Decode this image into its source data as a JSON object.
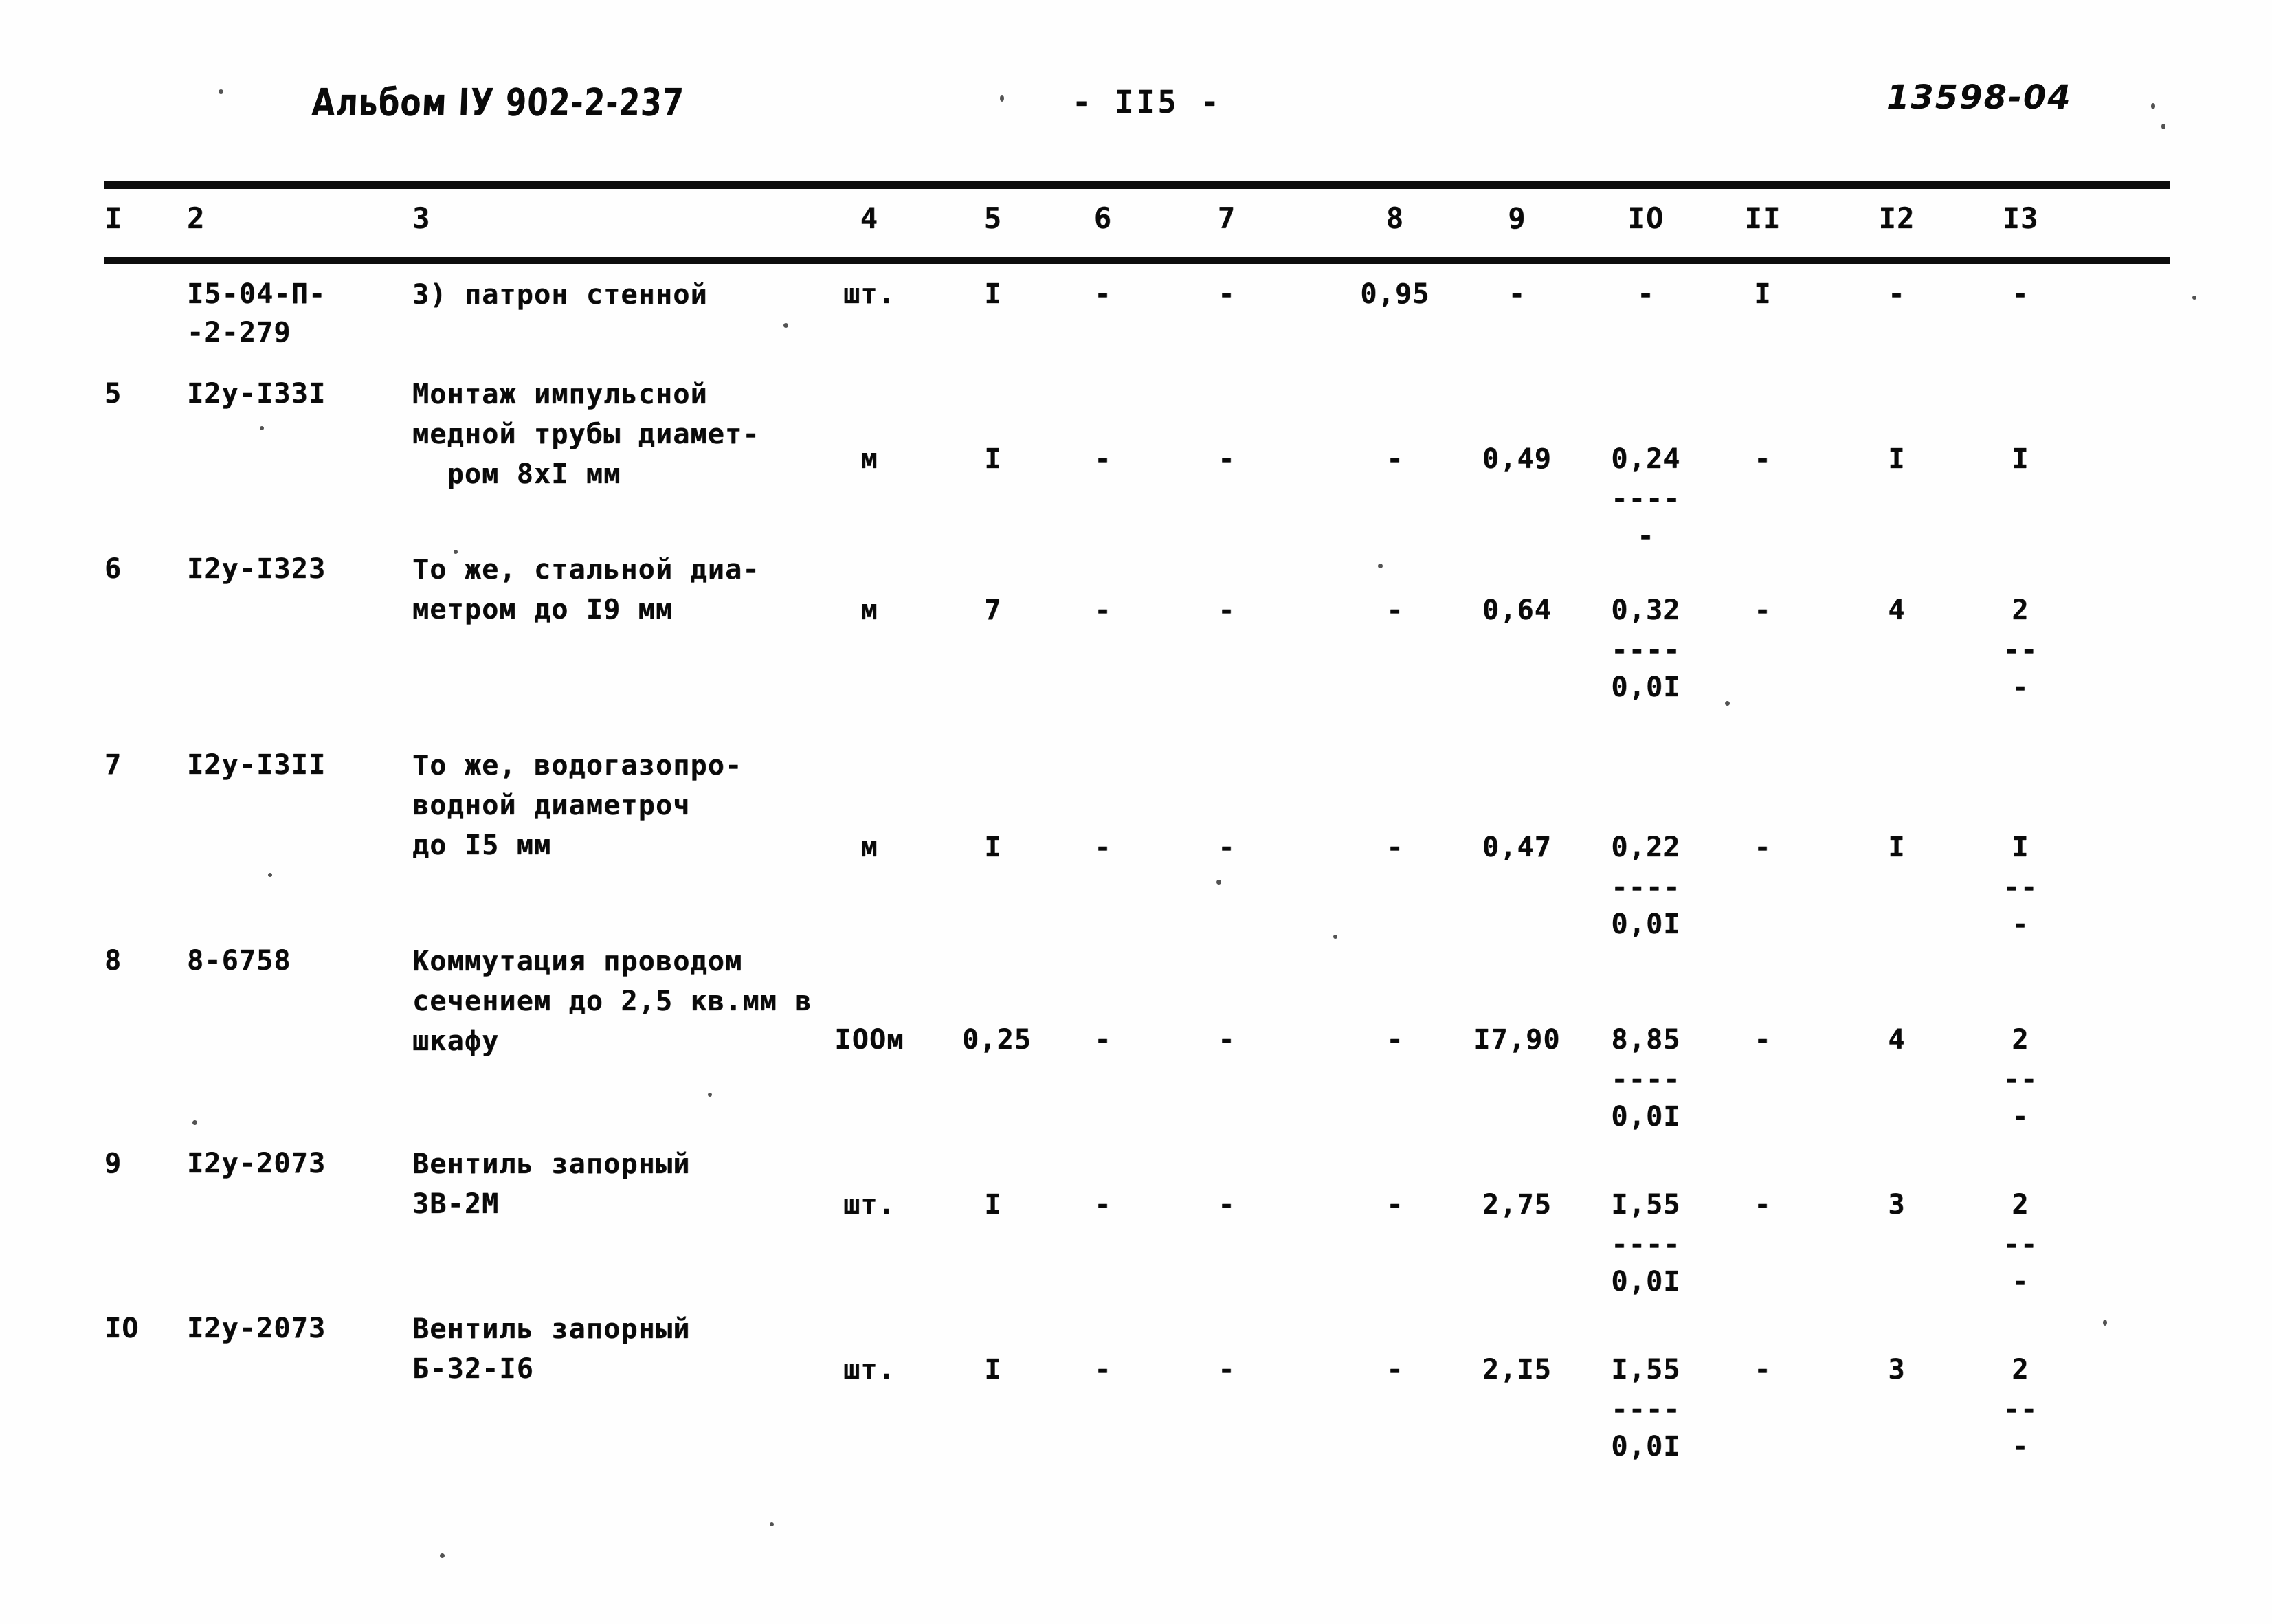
{
  "header": {
    "album_label": "Альбом IУ 902-2-237",
    "page_number": "- II5 -",
    "doc_code": "13598-04"
  },
  "table": {
    "column_headers": [
      "I",
      "2",
      "3",
      "4",
      "5",
      "6",
      "7",
      "8",
      "9",
      "IO",
      "II",
      "I2",
      "I3"
    ],
    "rows": [
      {
        "c1": "",
        "c2": "I5-04-П-\n-2-279",
        "c3": "3) патрон стенной",
        "c4": "шт.",
        "c5": "I",
        "c6": "-",
        "c7": "-",
        "c8": "0,95",
        "c9": "-",
        "c10": "-",
        "c11": "I",
        "c12": "-",
        "c13": "-"
      },
      {
        "c1": "5",
        "c2": "I2у-I33I",
        "c3": "Монтаж импульсной\nмедной трубы диамет-\n  ром 8хI мм",
        "c4": "м",
        "c5": "I",
        "c6": "-",
        "c7": "-",
        "c8": "-",
        "c9": "0,49",
        "c10": "0,24",
        "c10_rule": "----",
        "c10_sub": "-",
        "c11": "-",
        "c12": "I",
        "c13": "I"
      },
      {
        "c1": "6",
        "c2": "I2у-I323",
        "c3": "То же, стальной диа-\nметром до I9 мм",
        "c4": "м",
        "c5": "7",
        "c6": "-",
        "c7": "-",
        "c8": "-",
        "c9": "0,64",
        "c10": "0,32",
        "c10_rule": "----",
        "c10_sub": "0,0I",
        "c11": "-",
        "c12": "4",
        "c13": "2",
        "c13_rule": "--",
        "c13_sub": "-"
      },
      {
        "c1": "7",
        "c2": "I2у-I3II",
        "c3": "То же, водогазопро-\nводной диаметроч\nдо I5 мм",
        "c4": "м",
        "c5": "I",
        "c6": "-",
        "c7": "-",
        "c8": "-",
        "c9": "0,47",
        "c10": "0,22",
        "c10_rule": "----",
        "c10_sub": "0,0I",
        "c11": "-",
        "c12": "I",
        "c13": "I",
        "c13_rule": "--",
        "c13_sub": "-"
      },
      {
        "c1": "8",
        "c2": "8-6758",
        "c3": "Коммутация проводом\nсечением до 2,5 кв.мм в\nшкафу",
        "c4": "IООм",
        "c5": "0,25",
        "c6": "-",
        "c7": "-",
        "c8": "-",
        "c9": "I7,90",
        "c10": "8,85",
        "c10_rule": "----",
        "c10_sub": "0,0I",
        "c11": "-",
        "c12": "4",
        "c13": "2",
        "c13_rule": "--",
        "c13_sub": "-"
      },
      {
        "c1": "9",
        "c2": "I2у-2073",
        "c3": "Вентиль запорный\n3В-2М",
        "c4": "шт.",
        "c5": "I",
        "c6": "-",
        "c7": "-",
        "c8": "-",
        "c9": "2,75",
        "c10": "I,55",
        "c10_rule": "----",
        "c10_sub": "0,0I",
        "c11": "-",
        "c12": "3",
        "c13": "2",
        "c13_rule": "--",
        "c13_sub": "-"
      },
      {
        "c1": "IO",
        "c2": "I2у-2073",
        "c3": "Вентиль запорный\nБ-32-I6",
        "c4": "шт.",
        "c5": "I",
        "c6": "-",
        "c7": "-",
        "c8": "-",
        "c9": "2,I5",
        "c10": "I,55",
        "c10_rule": "----",
        "c10_sub": "0,0I",
        "c11": "-",
        "c12": "3",
        "c13": "2",
        "c13_rule": "--",
        "c13_sub": "-"
      }
    ]
  }
}
